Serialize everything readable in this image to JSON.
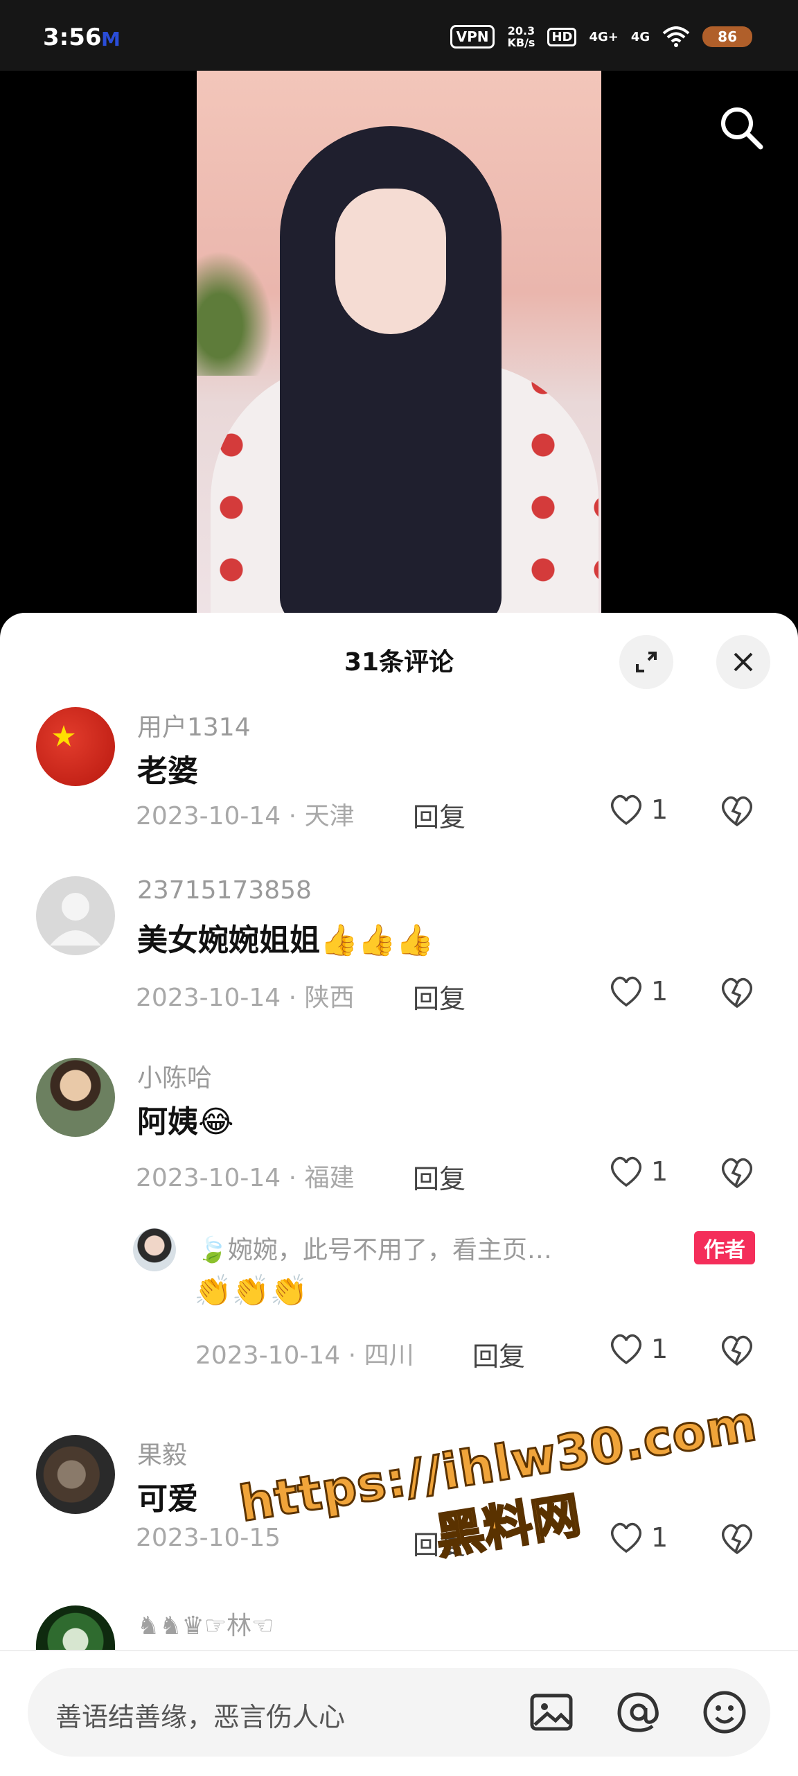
{
  "status_bar": {
    "time": "3:56",
    "carrier_icon": "M",
    "vpn": "VPN",
    "speed_value": "20.3",
    "speed_unit": "KB/s",
    "hd": "HD",
    "signal1": "4G+",
    "signal2": "4G",
    "battery": "86"
  },
  "video": {
    "search_icon": "search-icon"
  },
  "comments_panel": {
    "title": "31条评论",
    "expand_icon": "expand-icon",
    "close_icon": "close-icon",
    "comments": [
      {
        "user": "用户1314",
        "text": "老婆",
        "date": "2023-10-14",
        "location": "天津",
        "reply": "回复",
        "likes": "1",
        "sep": "·"
      },
      {
        "user": "23715173858",
        "text": "美女婉婉姐姐",
        "emoji": "👍👍👍",
        "date": "2023-10-14",
        "location": "陕西",
        "reply": "回复",
        "likes": "1",
        "sep": "·"
      },
      {
        "user": "小陈哈",
        "text": "阿姨",
        "emoji": "😂",
        "date": "2023-10-14",
        "location": "福建",
        "reply": "回复",
        "likes": "1",
        "sep": "·"
      },
      {
        "user": "果毅",
        "text": "可爱",
        "date": "2023-10-15",
        "location": "",
        "reply": "回复",
        "likes": "1",
        "sep": "·"
      },
      {
        "user": "♞♞♛☞林☜"
      }
    ],
    "author_reply": {
      "user": "🍃婉婉，此号不用了，看主页…",
      "badge": "作者",
      "emoji": "👏👏👏",
      "date": "2023-10-14",
      "location": "四川",
      "reply": "回复",
      "likes": "1",
      "sep": "·"
    }
  },
  "input_bar": {
    "placeholder": "善语结善缘，恶言伤人心",
    "image_icon": "image-icon",
    "at_icon": "at-icon",
    "emoji_icon": "smiley-icon"
  },
  "watermark": {
    "url": "https://ihlw30.com",
    "name": "黑料网"
  }
}
